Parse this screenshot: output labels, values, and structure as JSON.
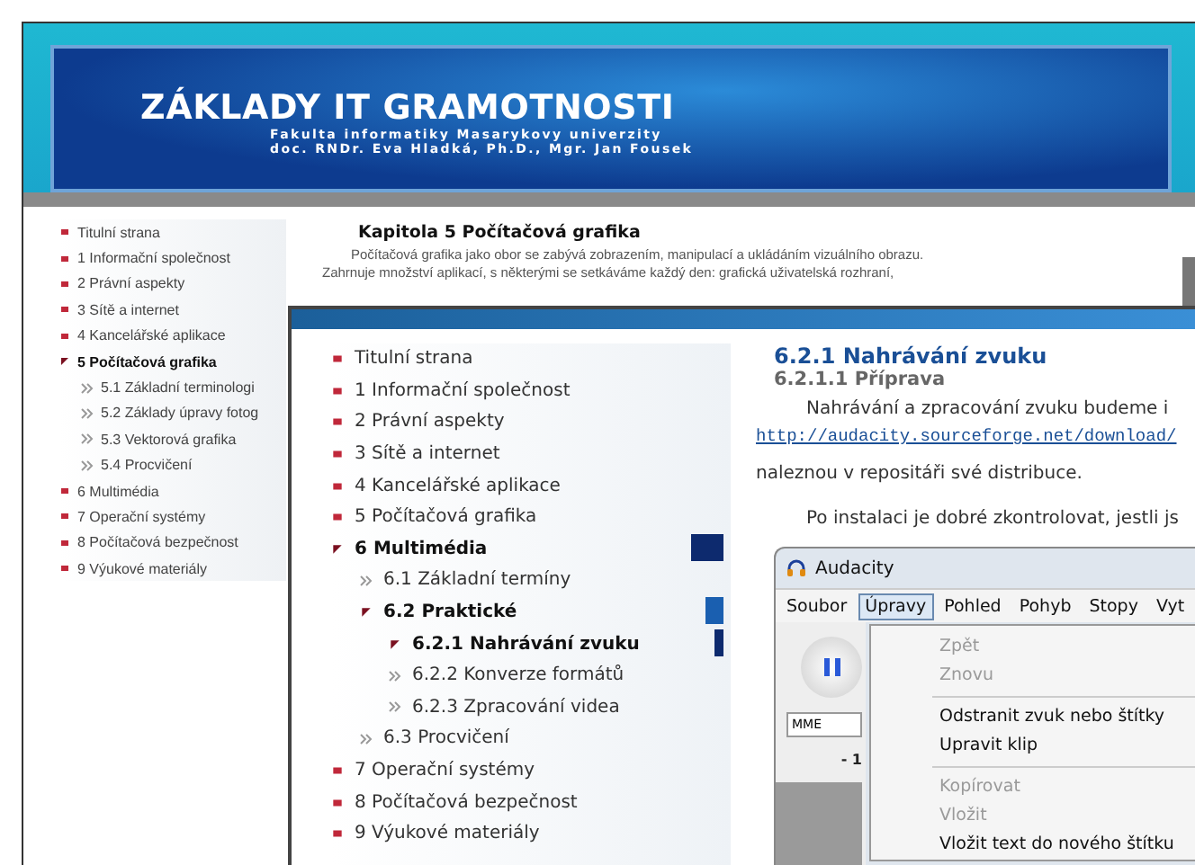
{
  "back_page": {
    "header": {
      "title": "ZÁKLADY IT GRAMOTNOSTI",
      "subtitle_lines": [
        "Fakulta informatiky Masarykovy univerzity",
        "doc. RNDr. Eva Hladká, Ph.D., Mgr. Jan Fousek"
      ]
    },
    "nav": [
      {
        "label": "Titulní strana",
        "selected": false
      },
      {
        "label": "1 Informační společnost",
        "selected": false
      },
      {
        "label": "2 Právní aspekty",
        "selected": false
      },
      {
        "label": "3 Sítě a internet",
        "selected": false
      },
      {
        "label": "4 Kancelářské aplikace",
        "selected": false
      },
      {
        "label": "5 Počítačová grafika",
        "selected": true,
        "children": [
          {
            "label": "5.1 Základní terminologi",
            "selected": false
          },
          {
            "label": "5.2 Základy úpravy fotog",
            "selected": false
          },
          {
            "label": "5.3 Vektorová grafika",
            "selected": false
          },
          {
            "label": "5.4 Procvičení",
            "selected": false
          }
        ]
      },
      {
        "label": "6 Multimédia",
        "selected": false
      },
      {
        "label": "7 Operační systémy",
        "selected": false
      },
      {
        "label": "8 Počítačová bezpečnost",
        "selected": false
      },
      {
        "label": "9 Výukové materiály",
        "selected": false
      }
    ],
    "article": {
      "heading": "Kapitola 5 Počítačová grafika",
      "paragraph_lines": [
        "Počítačová grafika jako obor se zabývá zobrazením, manipulací a ukládáním vizuálního obrazu.",
        "Zahrnuje množství aplikací, s některými se setkáváme každý den: grafická uživatelská rozhraní,"
      ]
    }
  },
  "front_page": {
    "nav": [
      {
        "label": "Titulní strana",
        "selected": false
      },
      {
        "label": "1 Informační společnost",
        "selected": false
      },
      {
        "label": "2 Právní aspekty",
        "selected": false
      },
      {
        "label": "3 Sítě a internet",
        "selected": false
      },
      {
        "label": "4 Kancelářské aplikace",
        "selected": false
      },
      {
        "label": "5 Počítačová grafika",
        "selected": false
      },
      {
        "label": "6 Multimédia",
        "selected": true,
        "children": [
          {
            "label": "6.1 Základní termíny",
            "selected": false
          },
          {
            "label": "6.2 Praktické",
            "selected": true,
            "children": [
              {
                "label": "6.2.1 Nahrávání zvuku",
                "selected": true
              },
              {
                "label": "6.2.2 Konverze formátů",
                "selected": false
              },
              {
                "label": "6.2.3 Zpracování videa",
                "selected": false
              }
            ]
          },
          {
            "label": "6.3 Procvičení",
            "selected": false
          }
        ]
      },
      {
        "label": "7 Operační systémy",
        "selected": false
      },
      {
        "label": "8 Počítačová bezpečnost",
        "selected": false
      },
      {
        "label": "9 Výukové materiály",
        "selected": false
      }
    ],
    "article": {
      "heading": "6.2.1 Nahrávání zvuku",
      "subheading": "6.2.1.1 Příprava",
      "paragraphs": [
        [
          {
            "kind": "indent",
            "text": "Nahrávání a zpracování zvuku budeme i"
          },
          {
            "kind": "link",
            "text": "http://audacity.sourceforge.net/download/"
          },
          {
            "kind": "plain",
            "text": "naleznou v repositáři své distribuce."
          }
        ],
        [
          {
            "kind": "indent",
            "text": "Po instalaci je dobré zkontrolovat, jestli js"
          }
        ]
      ]
    },
    "audacity": {
      "title": "Audacity",
      "menus": [
        {
          "label": "Soubor",
          "selected": false
        },
        {
          "label": "Úpravy",
          "selected": true
        },
        {
          "label": "Pohled",
          "selected": false
        },
        {
          "label": "Pohyb",
          "selected": false
        },
        {
          "label": "Stopy",
          "selected": false
        },
        {
          "label": "Vyt",
          "selected": false
        }
      ],
      "menu_items": [
        {
          "kind": "item",
          "label": "Zpět",
          "disabled": true
        },
        {
          "kind": "item",
          "label": "Znovu",
          "disabled": true
        },
        {
          "kind": "separator"
        },
        {
          "kind": "item",
          "label": "Odstranit zvuk nebo štítky",
          "disabled": false
        },
        {
          "kind": "item",
          "label": "Upravit klip",
          "disabled": false
        },
        {
          "kind": "separator"
        },
        {
          "kind": "item",
          "label": "Kopírovat",
          "disabled": true
        },
        {
          "kind": "item",
          "label": "Vložit",
          "disabled": true
        },
        {
          "kind": "item",
          "label": "Vložit text do nového štítku",
          "disabled": false
        }
      ],
      "device": "MME",
      "ruler_label": "- 1"
    }
  }
}
